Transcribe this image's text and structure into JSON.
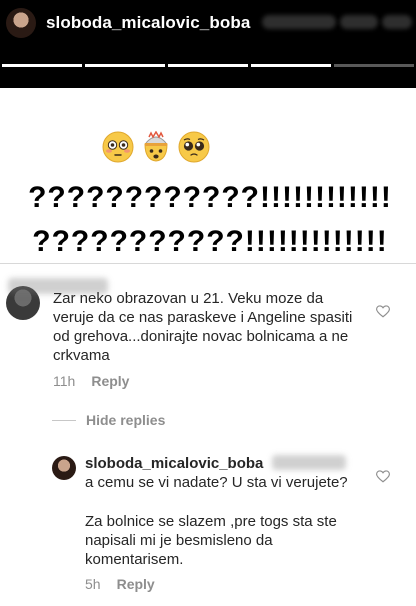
{
  "header": {
    "username": "sloboda_micalovic_boba"
  },
  "progress": {
    "total_segments": 5,
    "completed": 4
  },
  "story": {
    "emojis": [
      "flushed-face",
      "exploding-head",
      "pleading-face"
    ],
    "caption_line1": "????????????!!!!!!!!!!!!",
    "caption_line2": "???????????!!!!!!!!!!!!!"
  },
  "comment1": {
    "text": "Zar neko obrazovan  u 21. Veku moze da veruje da ce nas paraskeve  i Angeline spasiti od grehova...donirajte novac bolnicama a ne crkvama",
    "time": "11h",
    "reply_label": "Reply"
  },
  "replies_toggle": {
    "label": "Hide replies"
  },
  "reply1": {
    "username": "sloboda_micalovic_boba",
    "text_part1": "a cemu se vi nadate? U sta vi verujete?",
    "text_part2": "Za bolnice se slazem ,pre togs sta ste napisali mi je besmisleno da komentarisem.",
    "time": "5h",
    "reply_label": "Reply"
  },
  "colors": {
    "text": "#262626",
    "meta": "#8e8e8e",
    "background": "#ffffff",
    "header_bg": "#000000"
  }
}
